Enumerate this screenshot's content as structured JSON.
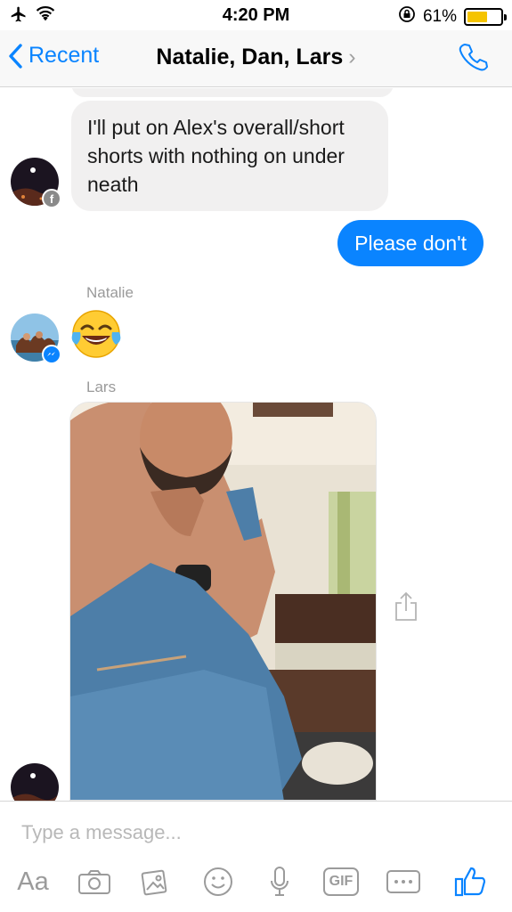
{
  "status_bar": {
    "time": "4:20 PM",
    "battery_text": "61%",
    "battery_level": 0.61,
    "icons": [
      "airplane-icon",
      "wifi-icon",
      "rotation-lock-icon",
      "battery-icon"
    ]
  },
  "nav": {
    "back_label": "Recent",
    "title": "Natalie, Dan, Lars",
    "title_chevron": "›",
    "call_icon": "phone-icon"
  },
  "messages": {
    "incoming_text": "I'll put on Alex's overall/short shorts with nothing on under neath",
    "outgoing_text": "Please don't",
    "sender_natalie": "Natalie",
    "natalie_reaction": "face-with-tears-of-joy-emoji",
    "sender_lars": "Lars",
    "lars_attachment": "photo"
  },
  "composer": {
    "placeholder": "Type a message...",
    "aa_label": "Aa",
    "gif_label": "GIF",
    "tools": [
      "text-format-icon",
      "camera-icon",
      "gallery-icon",
      "emoji-icon",
      "microphone-icon",
      "gif-icon",
      "more-icon",
      "thumbs-up-icon"
    ]
  },
  "colors": {
    "accent": "#0a84ff",
    "incoming_bubble": "#f1f0f0",
    "battery_fill": "#f5c400"
  }
}
